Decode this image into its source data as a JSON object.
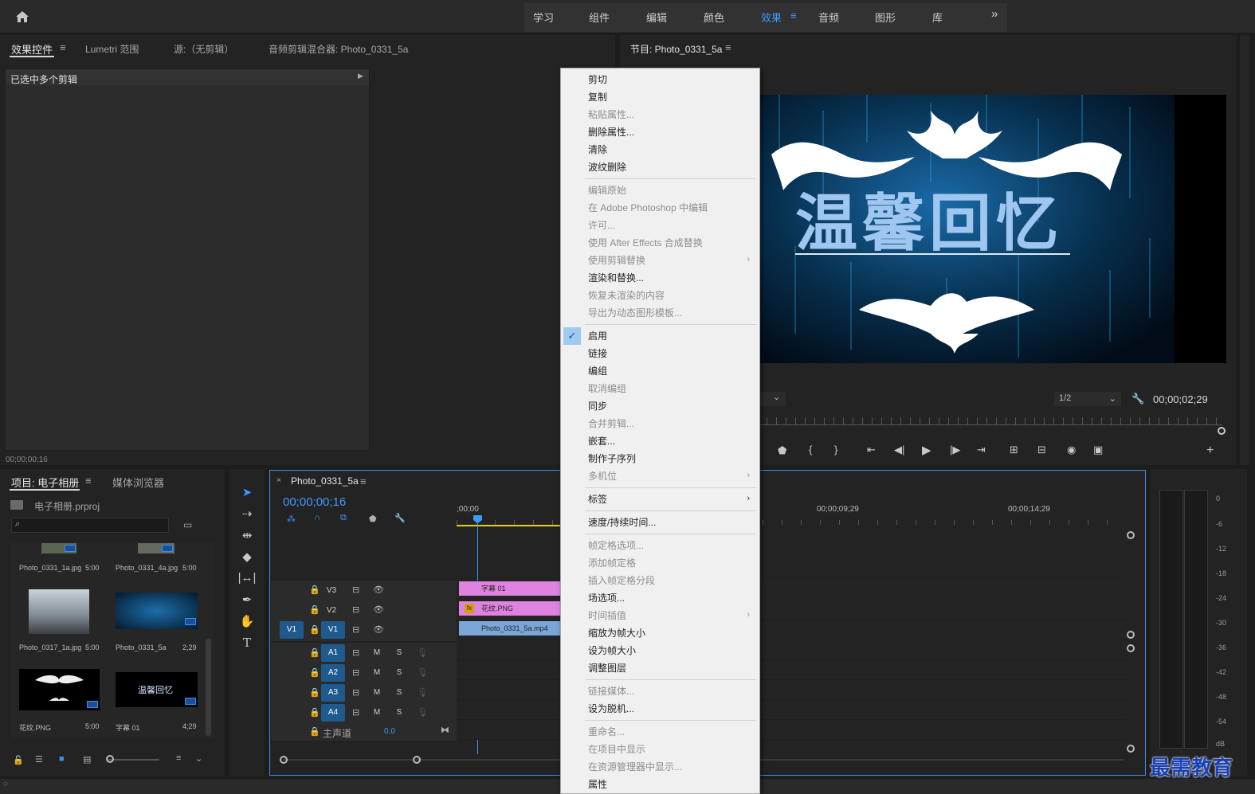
{
  "workspace": {
    "tabs": [
      "学习",
      "组件",
      "编辑",
      "颜色",
      "效果",
      "音频",
      "图形",
      "库"
    ],
    "active": "效果",
    "more": "»"
  },
  "effects_panel": {
    "tabs": [
      "效果控件",
      "Lumetri 范围",
      "源:（无剪辑）",
      "音频剪辑混合器: Photo_0331_5a"
    ],
    "header": "已选中多个剪辑",
    "timecode": "00;00;00;16"
  },
  "program_monitor": {
    "title": "节目: Photo_0331_5a",
    "preview_text": "温馨回忆",
    "resolution": "1/2",
    "timecode": "00;00;02;29"
  },
  "project_panel": {
    "tabs": [
      "项目: 电子相册",
      "媒体浏览器"
    ],
    "file": "电子相册.prproj",
    "items": [
      {
        "name": "Photo_0331_1a.jpg",
        "dur": "5:00"
      },
      {
        "name": "Photo_0331_4a.jpg",
        "dur": "5:00"
      },
      {
        "name": "Photo_0317_1a.jpg",
        "dur": "5:00"
      },
      {
        "name": "Photo_0331_5a",
        "dur": "2;29"
      },
      {
        "name": "花纹.PNG",
        "dur": "5:00"
      },
      {
        "name": "字幕 01",
        "dur": "4;29"
      }
    ],
    "preview_caption": "温馨回忆"
  },
  "timeline": {
    "sequence": "Photo_0331_5a",
    "timecode": "00;00;00;16",
    "ruler": [
      ";00;00",
      "00;00;09;29",
      "00;00;14;29"
    ],
    "video_tracks": [
      "V3",
      "V2",
      "V1"
    ],
    "source_patch": "V1",
    "audio_tracks": [
      "A1",
      "A2",
      "A3",
      "A4"
    ],
    "master_label": "主声道",
    "master_value": "0.0",
    "clips": [
      {
        "label": "字幕 01"
      },
      {
        "label": "花纹.PNG"
      },
      {
        "label": "Photo_0331_5a.mp4"
      }
    ],
    "mute": "M",
    "solo": "S"
  },
  "meter_scale": [
    "0",
    "-6",
    "-12",
    "-18",
    "-24",
    "-30",
    "-36",
    "-42",
    "-48",
    "-54",
    "dB"
  ],
  "context_menu": [
    {
      "label": "剪切",
      "enabled": true
    },
    {
      "label": "复制",
      "enabled": true
    },
    {
      "label": "粘贴属性...",
      "enabled": false
    },
    {
      "label": "删除属性...",
      "enabled": true
    },
    {
      "label": "清除",
      "enabled": true
    },
    {
      "label": "波纹删除",
      "enabled": true
    },
    {
      "sep": true
    },
    {
      "label": "编辑原始",
      "enabled": false
    },
    {
      "label": "在 Adobe Photoshop 中编辑",
      "enabled": false
    },
    {
      "label": "许可...",
      "enabled": false
    },
    {
      "label": "使用 After Effects 合成替换",
      "enabled": false
    },
    {
      "label": "使用剪辑替换",
      "enabled": false,
      "submenu": true
    },
    {
      "label": "渲染和替换...",
      "enabled": true
    },
    {
      "label": "恢复未渲染的内容",
      "enabled": false
    },
    {
      "label": "导出为动态图形模板...",
      "enabled": false
    },
    {
      "sep": true
    },
    {
      "label": "启用",
      "enabled": true,
      "checked": true
    },
    {
      "label": "链接",
      "enabled": true
    },
    {
      "label": "编组",
      "enabled": true
    },
    {
      "label": "取消编组",
      "enabled": false
    },
    {
      "label": "同步",
      "enabled": true
    },
    {
      "label": "合并剪辑...",
      "enabled": false
    },
    {
      "label": "嵌套...",
      "enabled": true
    },
    {
      "label": "制作子序列",
      "enabled": true
    },
    {
      "label": "多机位",
      "enabled": false,
      "submenu": true
    },
    {
      "sep": true
    },
    {
      "label": "标签",
      "enabled": true,
      "submenu": true
    },
    {
      "sep": true
    },
    {
      "label": "速度/持续时间...",
      "enabled": true
    },
    {
      "sep": true
    },
    {
      "label": "帧定格选项...",
      "enabled": false
    },
    {
      "label": "添加帧定格",
      "enabled": false
    },
    {
      "label": "插入帧定格分段",
      "enabled": false
    },
    {
      "label": "场选项...",
      "enabled": true
    },
    {
      "label": "时间插值",
      "enabled": false,
      "submenu": true
    },
    {
      "label": "缩放为帧大小",
      "enabled": true
    },
    {
      "label": "设为帧大小",
      "enabled": true
    },
    {
      "label": "调整图层",
      "enabled": true
    },
    {
      "sep": true
    },
    {
      "label": "链接媒体...",
      "enabled": false
    },
    {
      "label": "设为脱机...",
      "enabled": true
    },
    {
      "sep": true
    },
    {
      "label": "重命名...",
      "enabled": false
    },
    {
      "label": "在项目中显示",
      "enabled": false
    },
    {
      "label": "在资源管理器中显示...",
      "enabled": false
    },
    {
      "label": "属性",
      "enabled": true
    }
  ],
  "watermark": "最需教育"
}
